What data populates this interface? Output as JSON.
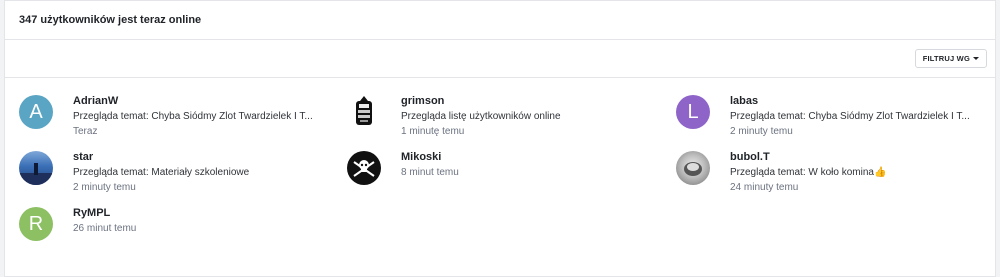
{
  "header": {
    "title": "347 użytkowników jest teraz online"
  },
  "toolbar": {
    "filter_label": "FILTRUJ WG"
  },
  "users": [
    {
      "name": "AdrianW",
      "activity": "Przegląda temat: Chyba Siódmy Zlot Twardzielek I T...",
      "time": "Teraz",
      "avatar_letter": "A",
      "avatar_color": "#5aa5c4"
    },
    {
      "name": "grimson",
      "activity": "Przegląda listę użytkowników online",
      "time": "1 minutę temu",
      "avatar_letter": "",
      "avatar_color": "#ffffff"
    },
    {
      "name": "labas",
      "activity": "Przegląda temat: Chyba Siódmy Zlot Twardzielek I T...",
      "time": "2 minuty temu",
      "avatar_letter": "L",
      "avatar_color": "#8e64c9"
    },
    {
      "name": "star",
      "activity": "Przegląda temat: Materiały szkoleniowe",
      "time": "2 minuty temu",
      "avatar_letter": "",
      "avatar_color": "#3a6fb6"
    },
    {
      "name": "Mikoski",
      "activity": "",
      "time": "8 minut temu",
      "avatar_letter": "",
      "avatar_color": "#111111"
    },
    {
      "name": "bubol.T",
      "activity": "Przegląda temat: W koło komina",
      "activity_emoji": "👍",
      "time": "24 minuty temu",
      "avatar_letter": "",
      "avatar_color": "#9a9a9a"
    },
    {
      "name": "RyMPL",
      "activity": "",
      "time": "26 minut temu",
      "avatar_letter": "R",
      "avatar_color": "#8cc063"
    }
  ]
}
